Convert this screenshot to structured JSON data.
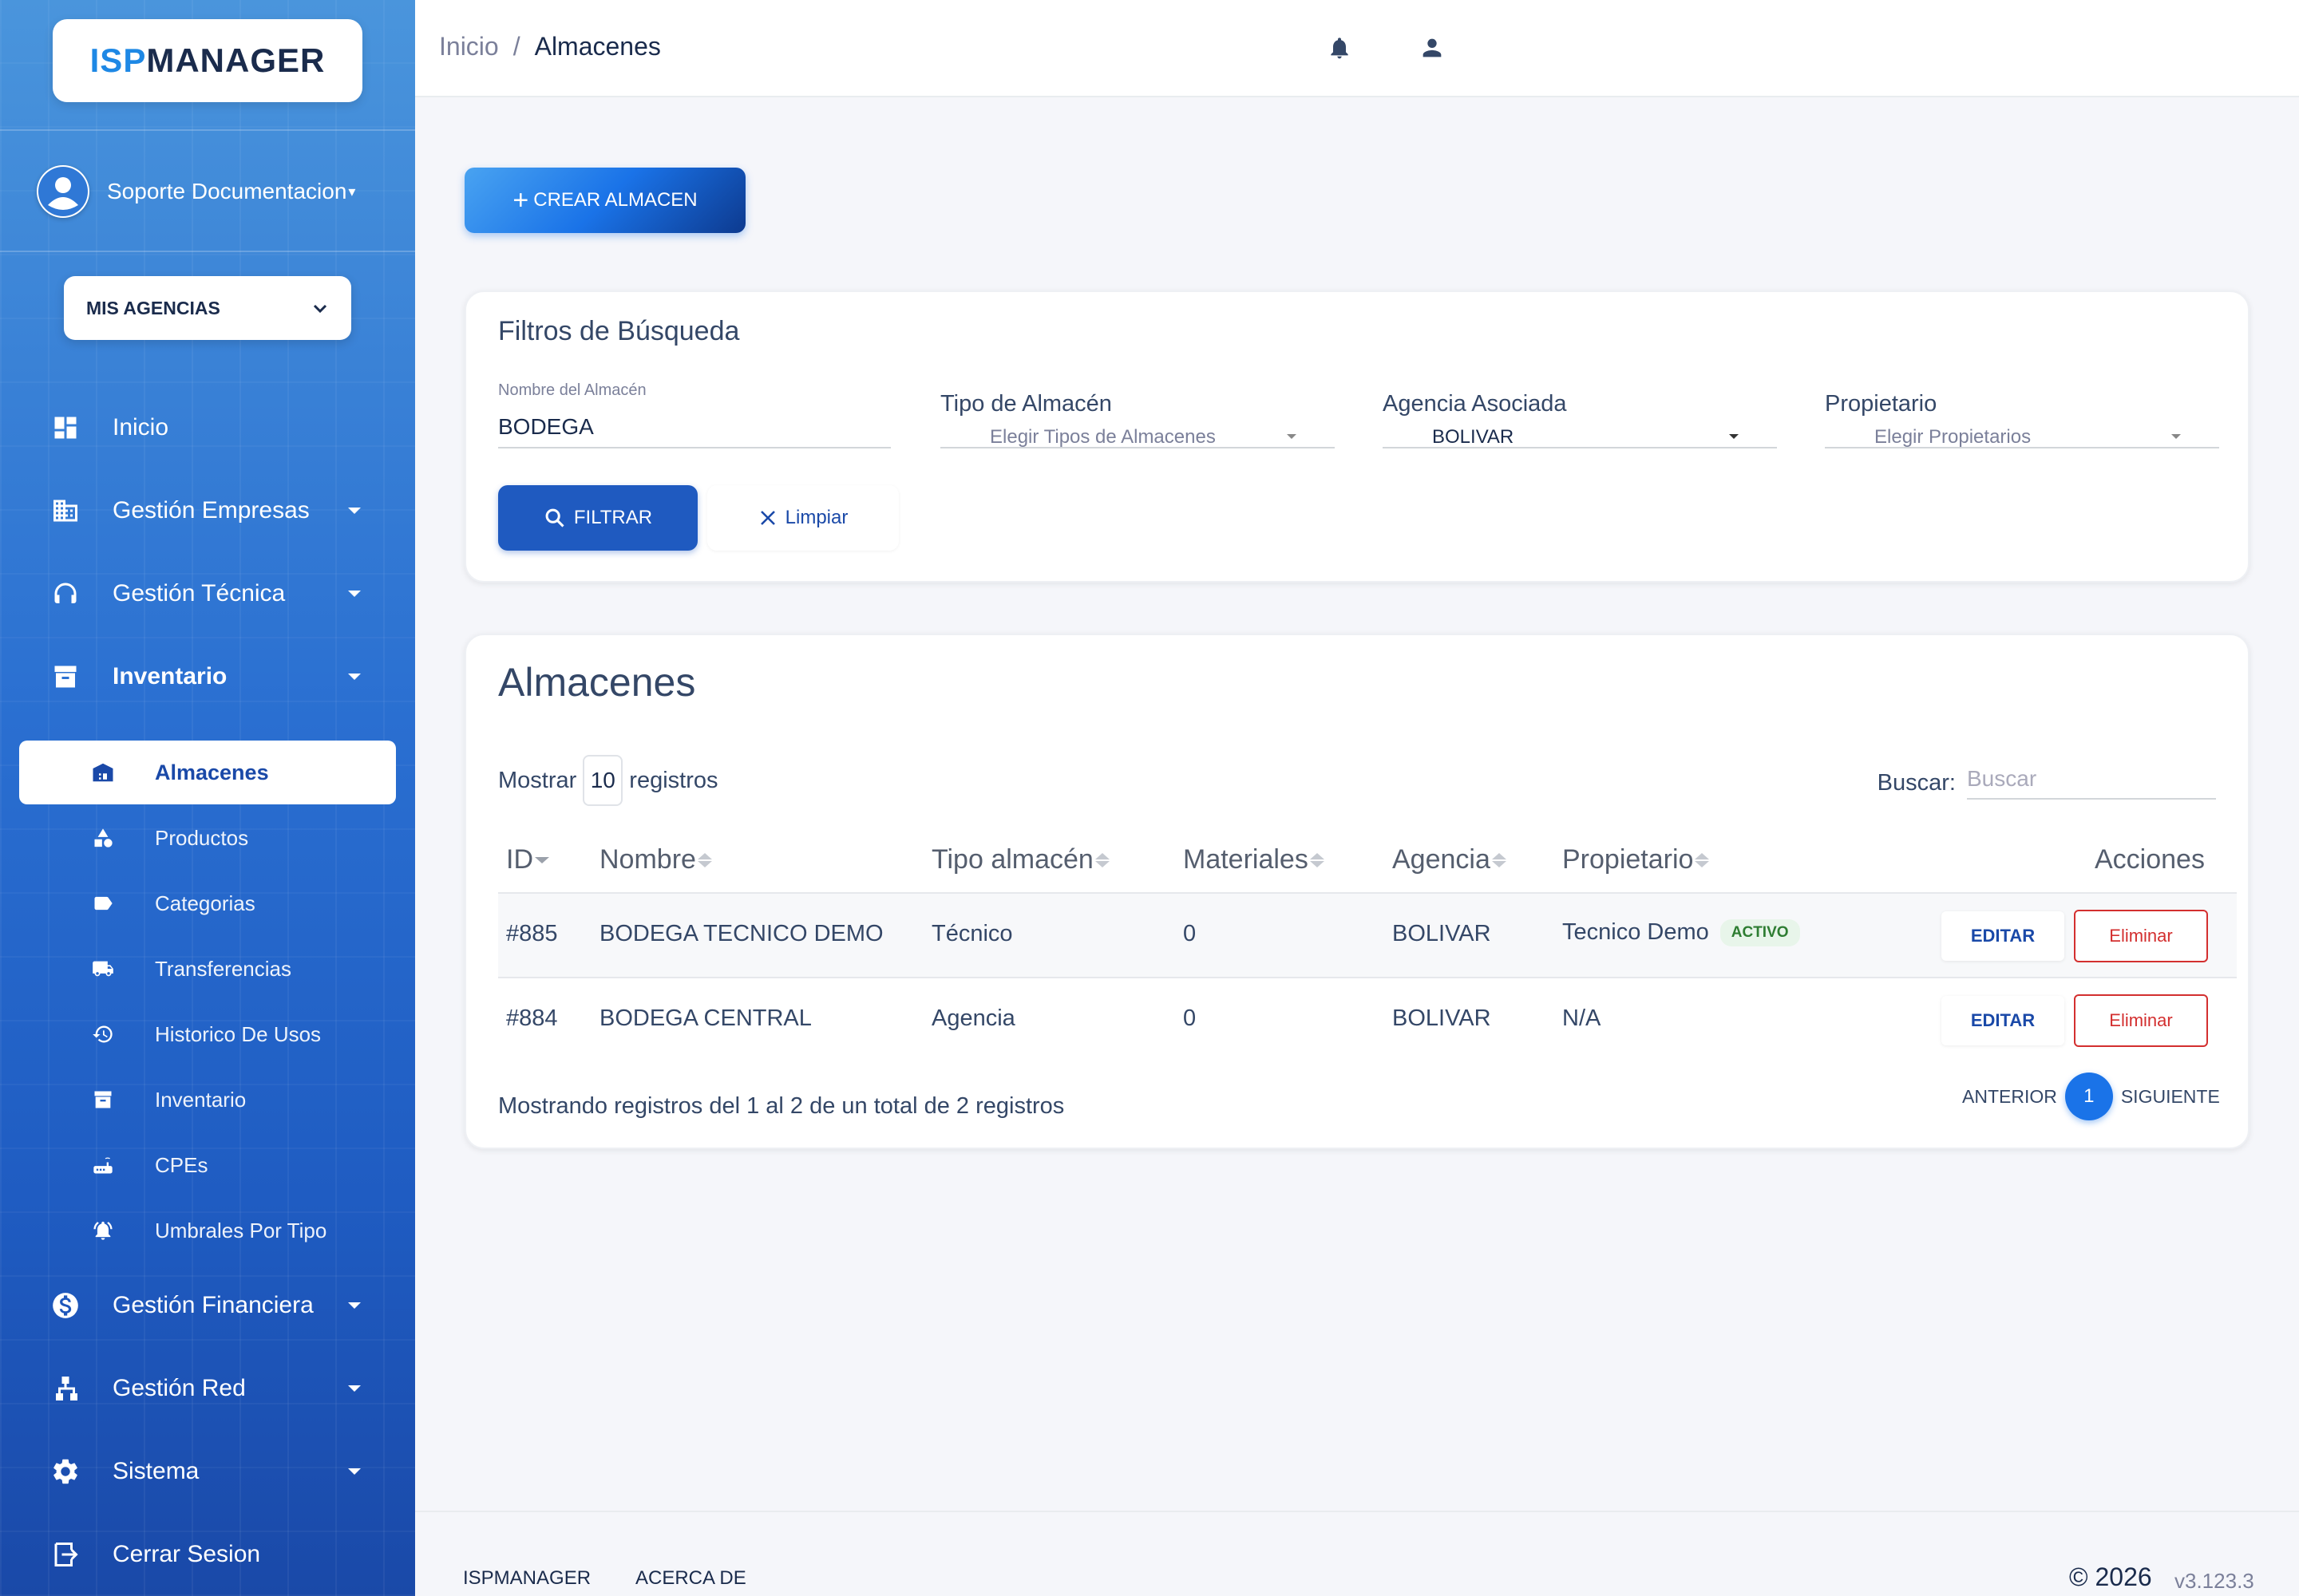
{
  "sidebar": {
    "logo": {
      "part1": "ISP",
      "part2": "MANAGER"
    },
    "user": {
      "name": "Soporte Documentacion"
    },
    "agency": {
      "label": "MIS AGENCIAS"
    },
    "nav": [
      {
        "label": "Inicio",
        "icon": "dashboard-icon"
      },
      {
        "label": "Gestión Empresas",
        "icon": "building-icon"
      },
      {
        "label": "Gestión Técnica",
        "icon": "support-agent-icon"
      },
      {
        "label": "Inventario",
        "icon": "archive-icon"
      },
      {
        "label": "Gestión Financiera",
        "icon": "dollar-icon"
      },
      {
        "label": "Gestión Red",
        "icon": "network-icon"
      },
      {
        "label": "Sistema",
        "icon": "gear-icon"
      },
      {
        "label": "Cerrar Sesion",
        "icon": "logout-icon"
      }
    ],
    "sub": [
      {
        "label": "Almacenes",
        "icon": "warehouse-icon",
        "active": true
      },
      {
        "label": "Productos",
        "icon": "category-icon"
      },
      {
        "label": "Categorias",
        "icon": "label-icon"
      },
      {
        "label": "Transferencias",
        "icon": "truck-icon"
      },
      {
        "label": "Historico De Usos",
        "icon": "history-icon"
      },
      {
        "label": "Inventario",
        "icon": "archive-icon"
      },
      {
        "label": "CPEs",
        "icon": "router-icon"
      },
      {
        "label": "Umbrales Por Tipo",
        "icon": "alarm-icon"
      }
    ]
  },
  "topbar": {
    "breadcrumb": {
      "home": "Inicio",
      "separator": "/",
      "current": "Almacenes"
    },
    "icons": [
      "bell-icon",
      "user-icon"
    ]
  },
  "actions": {
    "create_label": "CREAR ALMACEN"
  },
  "filters": {
    "title": "Filtros de Búsqueda",
    "name_label": "Nombre del Almacén",
    "name_value": "BODEGA",
    "type_label": "Tipo de Almacén",
    "type_placeholder": "Elegir Tipos de Almacenes",
    "agency_label": "Agencia Asociada",
    "agency_value": "BOLIVAR",
    "owner_label": "Propietario",
    "owner_placeholder": "Elegir Propietarios",
    "filter_btn": "FILTRAR",
    "clear_btn": "Limpiar"
  },
  "table": {
    "title": "Almacenes",
    "show_prefix": "Mostrar",
    "show_value": "10",
    "show_suffix": "registros",
    "search_label": "Buscar:",
    "search_placeholder": "Buscar",
    "columns": [
      "ID",
      "Nombre",
      "Tipo almacén",
      "Materiales",
      "Agencia",
      "Propietario",
      "Acciones"
    ],
    "rows": [
      {
        "id": "#885",
        "nombre": "BODEGA TECNICO DEMO",
        "tipo": "Técnico",
        "materiales": "0",
        "agencia": "BOLIVAR",
        "propietario": "Tecnico Demo",
        "badge": "ACTIVO",
        "edit": "EDITAR",
        "delete": "Eliminar"
      },
      {
        "id": "#884",
        "nombre": "BODEGA CENTRAL",
        "tipo": "Agencia",
        "materiales": "0",
        "agencia": "BOLIVAR",
        "propietario": "N/A",
        "badge": "",
        "edit": "EDITAR",
        "delete": "Eliminar"
      }
    ],
    "summary": "Mostrando registros del 1 al 2 de un total de 2 registros",
    "pager": {
      "prev": "ANTERIOR",
      "page": "1",
      "next": "SIGUIENTE"
    }
  },
  "footer": {
    "brand": "ISPMANAGER",
    "about": "ACERCA DE",
    "copyright": "© 2026",
    "version": "v3.123.3"
  },
  "colors": {
    "primary": "#1a73e8",
    "sidebar_top": "#4a95dc",
    "sidebar_bottom": "#1a49a8",
    "danger": "#d32f2f",
    "success": "#2e7d32"
  }
}
